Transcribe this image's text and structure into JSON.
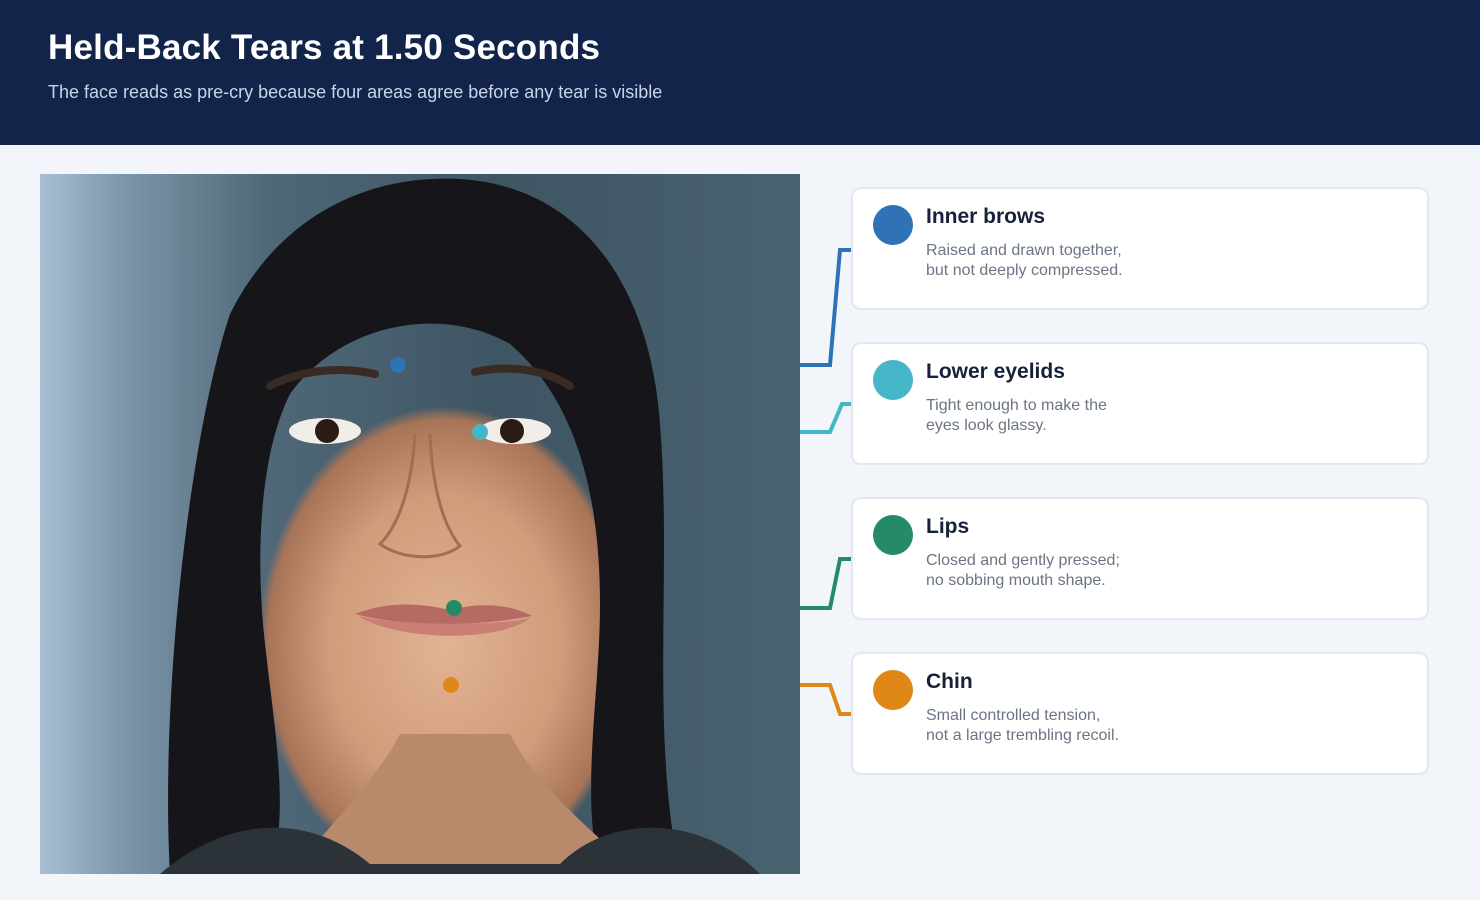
{
  "header": {
    "title": "Held-Back Tears at 1.50 Seconds",
    "subtitle": "The face reads as pre-cry because four areas agree before any tear is visible"
  },
  "colors": {
    "header_bg": "#13244a",
    "inner_brows": "#2f72b6",
    "lower_eyelids": "#44b6c7",
    "lips": "#258a68",
    "chin": "#df8817"
  },
  "cards": [
    {
      "title": "Inner brows",
      "line1": "Raised and drawn together,",
      "line2": "but not deeply compressed.",
      "icon": "blue-dot-icon"
    },
    {
      "title": "Lower eyelids",
      "line1": "Tight enough to make the",
      "line2": "eyes look glassy.",
      "icon": "teal-dot-icon"
    },
    {
      "title": "Lips",
      "line1": "Closed and gently pressed;",
      "line2": "no sobbing mouth shape.",
      "icon": "green-dot-icon"
    },
    {
      "title": "Chin",
      "line1": "Small controlled tension,",
      "line2": "not a large trembling recoil.",
      "icon": "orange-dot-icon"
    }
  ]
}
